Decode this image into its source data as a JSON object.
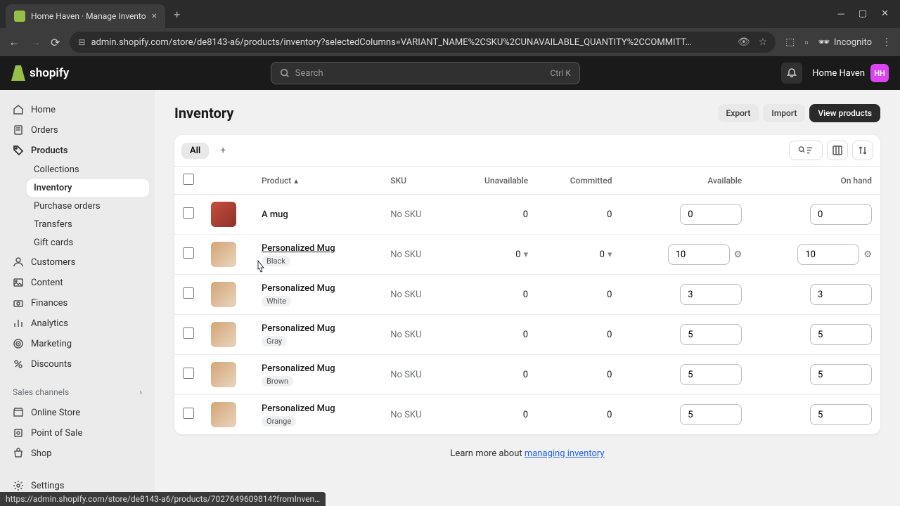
{
  "browser": {
    "tab_title": "Home Haven · Manage Invento",
    "url": "admin.shopify.com/store/de8143-a6/products/inventory?selectedColumns=VARIANT_NAME%2CSKU%2CUNAVAILABLE_QUANTITY%2CCOMMITT…",
    "incognito": "Incognito"
  },
  "header": {
    "logo_text": "shopify",
    "search_placeholder": "Search",
    "search_shortcut": "Ctrl K",
    "store_name": "Home Haven",
    "store_initials": "HH"
  },
  "sidebar": {
    "home": "Home",
    "orders": "Orders",
    "products": "Products",
    "collections": "Collections",
    "inventory": "Inventory",
    "purchase_orders": "Purchase orders",
    "transfers": "Transfers",
    "gift_cards": "Gift cards",
    "customers": "Customers",
    "content": "Content",
    "finances": "Finances",
    "analytics": "Analytics",
    "marketing": "Marketing",
    "discounts": "Discounts",
    "sales_channels": "Sales channels",
    "online_store": "Online Store",
    "point_of_sale": "Point of Sale",
    "shop": "Shop",
    "settings": "Settings"
  },
  "page": {
    "title": "Inventory",
    "export": "Export",
    "import": "Import",
    "view_products": "View products",
    "tab_all": "All"
  },
  "columns": {
    "product": "Product",
    "sku": "SKU",
    "unavailable": "Unavailable",
    "committed": "Committed",
    "available": "Available",
    "on_hand": "On hand"
  },
  "rows": [
    {
      "name": "A mug",
      "variant": "",
      "sku": "No SKU",
      "unavailable": "0",
      "committed": "0",
      "available": "0",
      "on_hand": "0",
      "hovered": false,
      "plain": true,
      "thumb_class": "mug"
    },
    {
      "name": "Personalized Mug",
      "variant": "Black",
      "sku": "No SKU",
      "unavailable": "0",
      "committed": "0",
      "available": "10",
      "on_hand": "10",
      "hovered": true,
      "plain": false,
      "thumb_class": ""
    },
    {
      "name": "Personalized Mug",
      "variant": "White",
      "sku": "No SKU",
      "unavailable": "0",
      "committed": "0",
      "available": "3",
      "on_hand": "3",
      "hovered": false,
      "plain": false,
      "thumb_class": ""
    },
    {
      "name": "Personalized Mug",
      "variant": "Gray",
      "sku": "No SKU",
      "unavailable": "0",
      "committed": "0",
      "available": "5",
      "on_hand": "5",
      "hovered": false,
      "plain": false,
      "thumb_class": ""
    },
    {
      "name": "Personalized Mug",
      "variant": "Brown",
      "sku": "No SKU",
      "unavailable": "0",
      "committed": "0",
      "available": "5",
      "on_hand": "5",
      "hovered": false,
      "plain": false,
      "thumb_class": ""
    },
    {
      "name": "Personalized Mug",
      "variant": "Orange",
      "sku": "No SKU",
      "unavailable": "0",
      "committed": "0",
      "available": "5",
      "on_hand": "5",
      "hovered": false,
      "plain": false,
      "thumb_class": ""
    }
  ],
  "footer": {
    "learn_text": "Learn more about ",
    "learn_link": "managing inventory"
  },
  "status_bar": "https://admin.shopify.com/store/de8143-a6/products/7027649609814?fromInven…"
}
